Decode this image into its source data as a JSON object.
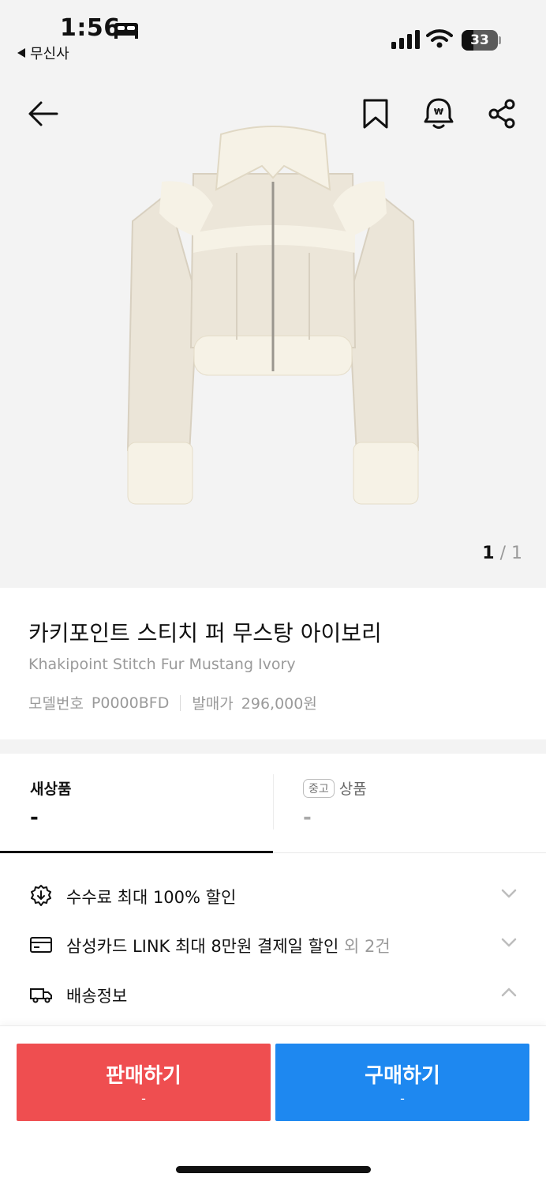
{
  "status_bar": {
    "time": "1:56",
    "back_app": "무신사",
    "battery": "33",
    "battery_level": 0.33
  },
  "hero": {
    "pager_current": "1",
    "pager_total": "/ 1"
  },
  "product": {
    "title_ko": "카키포인트 스티치 퍼 무스탕 아이보리",
    "title_en": "Khakipoint Stitch Fur Mustang Ivory",
    "model_label": "모델번호",
    "model_value": "P0000BFD",
    "release_label": "발매가",
    "release_value": "296,000원"
  },
  "tabs": {
    "new_label": "새상품",
    "new_price": "-",
    "used_badge": "중고",
    "used_label": "상품",
    "used_price": "-"
  },
  "info": {
    "fee": "수수료 최대 100% 할인",
    "card": "삼성카드 LINK 최대 8만원 결제일 할인",
    "card_more": " 외 2건",
    "shipping": "배송정보"
  },
  "bottom": {
    "sell_label": "판매하기",
    "sell_price": "-",
    "buy_label": "구매하기",
    "buy_price": "-"
  },
  "colors": {
    "sell": "#ef4e50",
    "buy": "#1e88f0"
  }
}
